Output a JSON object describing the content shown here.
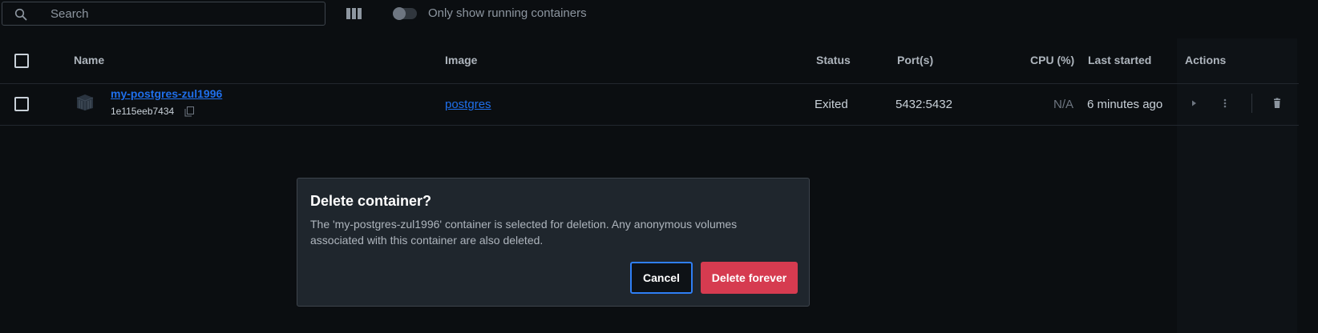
{
  "toolbar": {
    "search_placeholder": "Search",
    "toggle_label": "Only show running containers",
    "toggle_on": false
  },
  "table": {
    "headers": {
      "name": "Name",
      "image": "Image",
      "status": "Status",
      "ports": "Port(s)",
      "cpu": "CPU (%)",
      "last_started": "Last started",
      "actions": "Actions"
    },
    "rows": [
      {
        "name": "my-postgres-zul1996",
        "id": "1e115eeb7434",
        "image": "postgres",
        "status": "Exited",
        "ports": "5432:5432",
        "cpu": "N/A",
        "last_started": "6 minutes ago"
      }
    ]
  },
  "dialog": {
    "title": "Delete container?",
    "body": "The 'my-postgres-zul1996' container is selected for deletion. Any anonymous volumes associated with this container are also deleted.",
    "cancel_label": "Cancel",
    "confirm_label": "Delete forever"
  },
  "colors": {
    "background": "#0b0e11",
    "link": "#1f6feb",
    "danger": "#d63b50",
    "focus": "#2f7ff5",
    "dialog_bg": "#1f262d"
  },
  "icons": [
    "search-icon",
    "columns-icon",
    "container-icon",
    "copy-icon",
    "play-icon",
    "more-icon",
    "trash-icon"
  ]
}
